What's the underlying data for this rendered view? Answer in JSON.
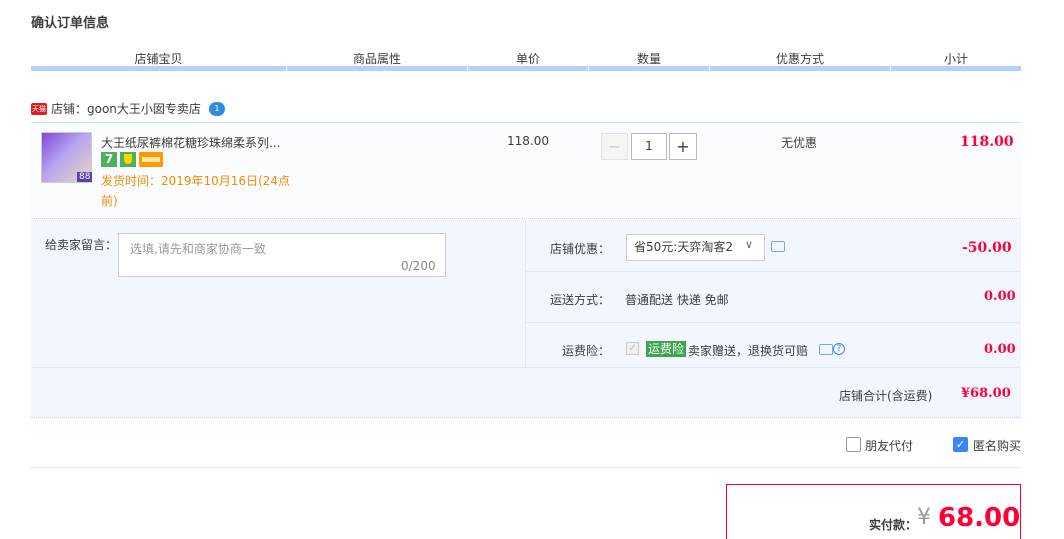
{
  "page": {
    "title": "确认订单信息"
  },
  "columns": [
    "店铺宝贝",
    "商品属性",
    "单价",
    "数量",
    "优惠方式",
    "小计"
  ],
  "shop": {
    "badge": "天猫",
    "label": "店铺：goon大王小囡专卖店",
    "chat_badge": "1"
  },
  "item": {
    "name": "大王纸尿裤棉花糖珍珠绵柔系列...",
    "thumb_tag": "88",
    "badge_7": "7",
    "ship_time": "发货时间：2019年10月16日(24点前)",
    "unit_price": "118.00",
    "quantity": "1",
    "minus": "−",
    "plus": "+",
    "discount": "无优惠",
    "subtotal": "118.00"
  },
  "message": {
    "label": "给卖家留言：",
    "placeholder": "选填,请先和商家协商一致",
    "count": "0/200"
  },
  "store_discount": {
    "label": "店铺优惠：",
    "selected": "省50元:天弈淘客2",
    "value": "-50.00"
  },
  "shipping": {
    "label": "运送方式：",
    "value": "普通配送 快递 免邮",
    "amount": "0.00"
  },
  "insurance": {
    "label": "运费险：",
    "tag": "运费险",
    "text": "卖家赠送，退换货可赔",
    "amount": "0.00",
    "help": "?"
  },
  "store_total": {
    "label": "店铺合计(含运费)",
    "value": "¥68.00"
  },
  "options": {
    "friend_pay": {
      "label": "朋友代付",
      "checked": false
    },
    "anonymous": {
      "label": "匿名购买",
      "checked": true
    }
  },
  "payment": {
    "label": "实付款：",
    "currency": "¥",
    "amount": "68.00"
  },
  "colors": {
    "accent_red": "#ff0036",
    "header_line": "#b2d1ff",
    "panel_bg": "#f2f7ff"
  }
}
